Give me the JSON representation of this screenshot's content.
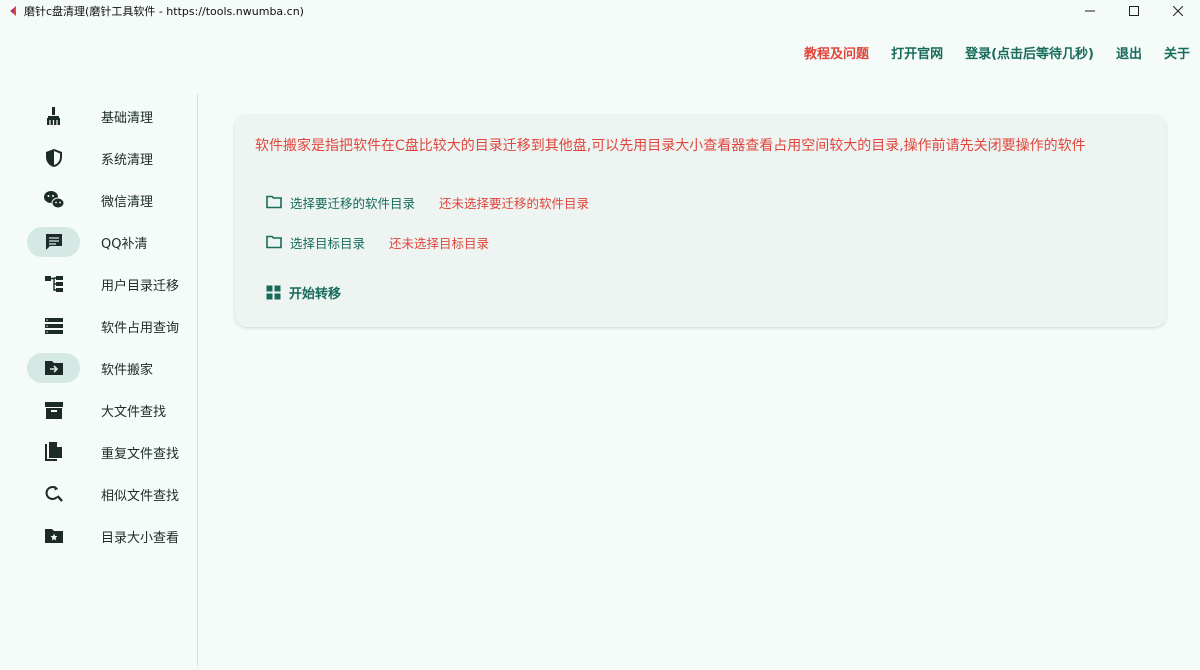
{
  "window": {
    "title": "磨针c盘清理(磨针工具软件 - https://tools.nwumba.cn)",
    "minimize": "—",
    "maximize": "☐",
    "close": "✕"
  },
  "topnav": {
    "items": [
      {
        "label": "教程及问题",
        "style": "red"
      },
      {
        "label": "打开官网"
      },
      {
        "label": "登录(点击后等待几秒)"
      },
      {
        "label": "退出"
      },
      {
        "label": "关于"
      }
    ]
  },
  "sidebar": {
    "items": [
      {
        "label": "基础清理",
        "icon": "broom-icon"
      },
      {
        "label": "系统清理",
        "icon": "shield-icon"
      },
      {
        "label": "微信清理",
        "icon": "wechat-icon"
      },
      {
        "label": "QQ补清",
        "icon": "chat-bubble-icon"
      },
      {
        "label": "用户目录迁移",
        "icon": "tree-icon"
      },
      {
        "label": "软件占用查询",
        "icon": "list-icon"
      },
      {
        "label": "软件搬家",
        "icon": "folder-move-icon"
      },
      {
        "label": "大文件查找",
        "icon": "archive-icon"
      },
      {
        "label": "重复文件查找",
        "icon": "copy-file-icon"
      },
      {
        "label": "相似文件查找",
        "icon": "find-replace-icon"
      },
      {
        "label": "目录大小查看",
        "icon": "folder-star-icon"
      }
    ],
    "active_index": 6
  },
  "main": {
    "description": "软件搬家是指把软件在C盘比较大的目录迁移到其他盘,可以先用目录大小查看器查看占用空间较大的目录,操作前请先关闭要操作的软件",
    "select_source_label": "选择要迁移的软件目录",
    "select_source_status": "还未选择要迁移的软件目录",
    "select_target_label": "选择目标目录",
    "select_target_status": "还未选择目标目录",
    "start_label": "开始转移"
  },
  "colors": {
    "accent": "#176b5b",
    "warning": "#e0463c",
    "background": "#f4fbf8",
    "card": "#eef4f2",
    "active_pill": "#d4e9e3"
  }
}
